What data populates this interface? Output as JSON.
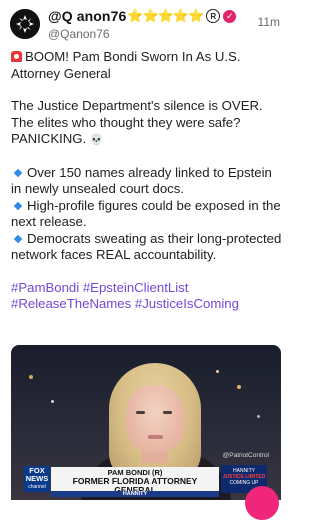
{
  "post": {
    "display_name": "@Q anon76",
    "stars": "⭐⭐⭐⭐⭐",
    "reg_mark": "R",
    "handle": "@Qanon76",
    "time": "11m",
    "headline": "BOOM! Pam Bondi Sworn In As U.S. Attorney General",
    "paragraph": "The Justice Department's silence is OVER. The elites who thought they were safe? PANICKING.",
    "skull": "💀",
    "bullets": [
      "Over 150 names already linked to Epstein in newly unsealed court docs.",
      "High-profile figures could be exposed in the next release.",
      "Democrats sweating as their long-protected network faces REAL accountability."
    ],
    "hashtags_line1": "#PamBondi #EpsteinClientList",
    "hashtags_line2": "#ReleaseTheNames #JusticeIsComing"
  },
  "media": {
    "watermark": "@PatriotControl",
    "logo_line1": "FOX",
    "logo_line2": "NEWS",
    "logo_line3": "channel",
    "chyron_name": "PAM BONDI (R)",
    "chyron_title": "FORMER FLORIDA ATTORNEY GENERAL",
    "show_name": "HANNITY",
    "promo_line1": "HANNITY",
    "promo_line2": "JUSTICE LIMITED",
    "promo_line3": "COMING UP"
  },
  "colors": {
    "hashtag": "#6f4ad8",
    "verified": "#e2246b",
    "accent_button": "#f0267a"
  }
}
